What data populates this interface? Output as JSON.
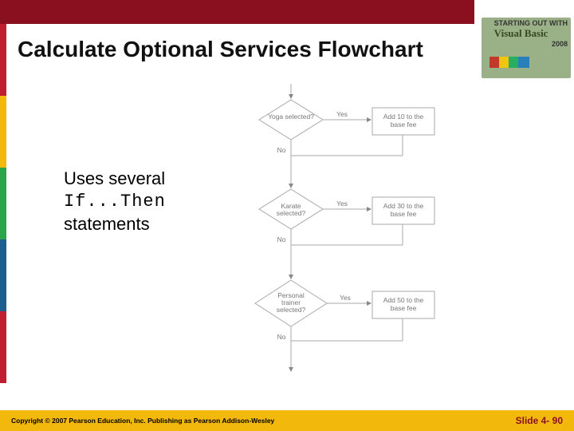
{
  "header": {
    "title": "Calculate Optional Services Flowchart",
    "logo_line1": "STARTING OUT WITH",
    "logo_brand": "Visual Basic",
    "logo_year": "2008"
  },
  "note": {
    "line1": "Uses several",
    "code": "If...Then",
    "line2": "statements"
  },
  "flowchart": {
    "decisions": [
      {
        "label": "Yoga selected?",
        "action": "Add 10 to the base fee",
        "yes": "Yes",
        "no": "No"
      },
      {
        "label": "Karate selected?",
        "action": "Add 30 to the base fee",
        "yes": "Yes",
        "no": "No"
      },
      {
        "label": "Personal trainer selected?",
        "action": "Add 50 to the base fee",
        "yes": "Yes",
        "no": "No"
      }
    ]
  },
  "footer": {
    "copyright": "Copyright © 2007 Pearson Education, Inc. Publishing as Pearson Addison-Wesley",
    "slide": "Slide 4- 90"
  }
}
